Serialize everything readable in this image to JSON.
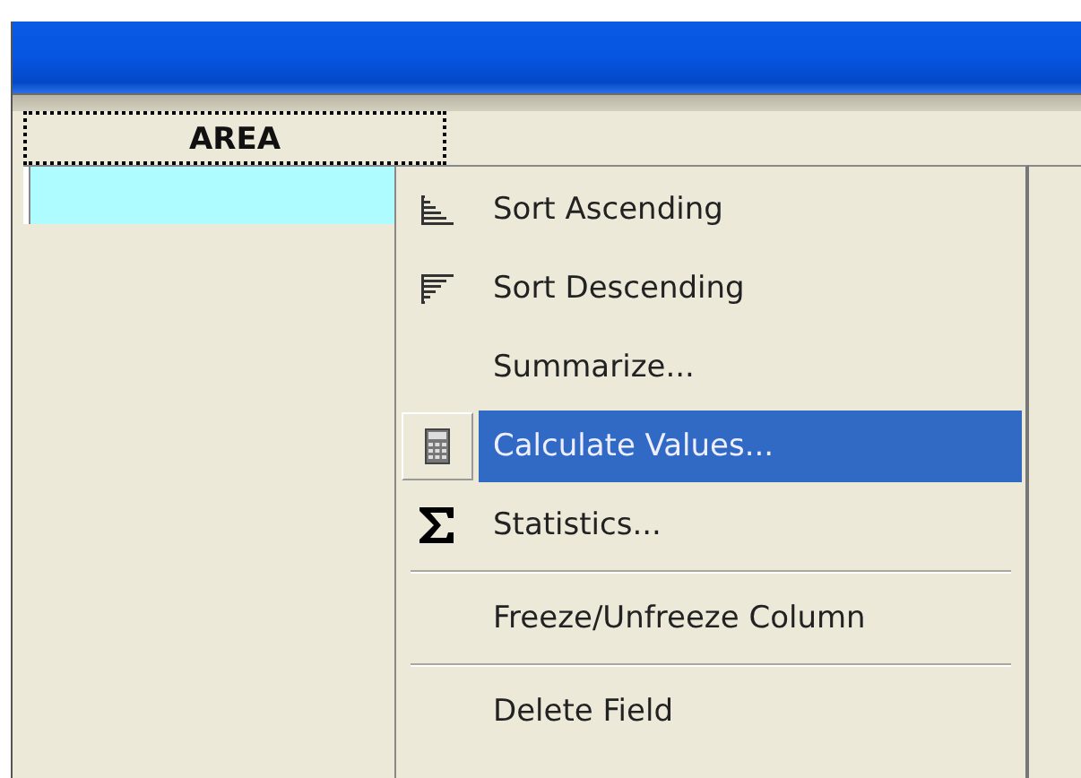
{
  "table": {
    "columns": [
      {
        "label": "AREA",
        "focused": true
      }
    ],
    "rows": [
      {
        "selected": true
      }
    ]
  },
  "context_menu": {
    "items": [
      {
        "kind": "ascending",
        "label": "Sort Ascending",
        "selected": false
      },
      {
        "kind": "descending",
        "label": "Sort Descending",
        "selected": false
      },
      {
        "kind": "plain",
        "label": "Summarize...",
        "selected": false
      },
      {
        "kind": "calculator",
        "label": "Calculate Values...",
        "selected": true
      },
      {
        "kind": "sigma",
        "label": "Statistics...",
        "selected": false
      },
      {
        "kind": "separator"
      },
      {
        "kind": "plain",
        "label": "Freeze/Unfreeze Column",
        "selected": false
      },
      {
        "kind": "separator"
      },
      {
        "kind": "plain",
        "label": "Delete Field",
        "selected": false
      }
    ]
  }
}
